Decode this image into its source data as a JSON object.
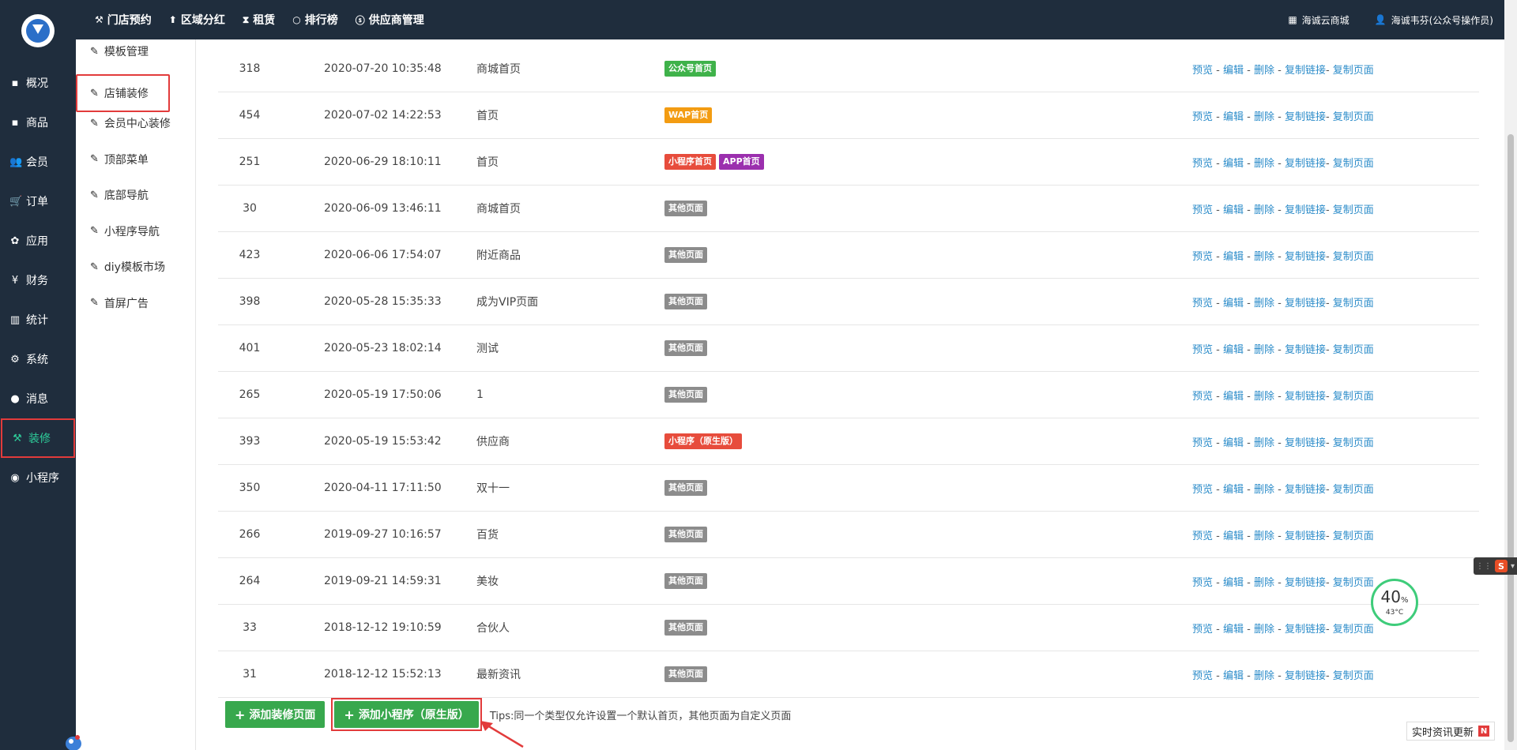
{
  "topnav": [
    {
      "icon": "hammer-icon",
      "glyph": "⚒",
      "label": "门店预约"
    },
    {
      "icon": "pin-icon",
      "glyph": "⬆",
      "label": "区域分红"
    },
    {
      "icon": "hourglass-icon",
      "glyph": "⧗",
      "label": "租赁"
    },
    {
      "icon": "circle-icon",
      "glyph": "○",
      "label": "排行榜"
    },
    {
      "icon": "skype-icon",
      "glyph": "ⓢ",
      "label": "供应商管理"
    }
  ],
  "topright": {
    "shop_label": "海诚云商城",
    "user_label": "海诚韦芬(公众号操作员)"
  },
  "sidebar": [
    {
      "icon": "overview-icon",
      "glyph": "▪",
      "label": "概况"
    },
    {
      "icon": "goods-icon",
      "glyph": "▪",
      "label": "商品"
    },
    {
      "icon": "members-icon",
      "glyph": "👥",
      "label": "会员"
    },
    {
      "icon": "cart-icon",
      "glyph": "🛒",
      "label": "订单"
    },
    {
      "icon": "apps-icon",
      "glyph": "✿",
      "label": "应用"
    },
    {
      "icon": "yen-icon",
      "glyph": "¥",
      "label": "财务"
    },
    {
      "icon": "chart-icon",
      "glyph": "▥",
      "label": "统计"
    },
    {
      "icon": "settings-icon",
      "glyph": "⚙",
      "label": "系统"
    },
    {
      "icon": "message-icon",
      "glyph": "●",
      "label": "消息"
    },
    {
      "icon": "decorate-icon",
      "glyph": "⚒",
      "label": "装修",
      "active": true
    },
    {
      "icon": "wechat-icon",
      "glyph": "◉",
      "label": "小程序"
    }
  ],
  "submenu": [
    {
      "label": "模板管理"
    },
    {
      "label": "店铺装修",
      "active": true
    },
    {
      "label": "会员中心装修"
    },
    {
      "label": "顶部菜单"
    },
    {
      "label": "底部导航"
    },
    {
      "label": "小程序导航"
    },
    {
      "label": "diy模板市场"
    },
    {
      "label": "首屏广告"
    }
  ],
  "tag_colors": {
    "公众号首页": "#3fb24a",
    "WAP首页": "#f39c12",
    "小程序首页": "#e74c3c",
    "APP首页": "#9b2fae",
    "其他页面": "#8c8c8c",
    "小程序（原生版）": "#e74c3c"
  },
  "ops": {
    "preview": "预览",
    "edit": "编辑",
    "delete": "删除",
    "copy_link": "复制链接",
    "copy_page": "复制页面"
  },
  "rows": [
    {
      "id": "318",
      "date": "2020-07-20 10:35:48",
      "name": "商城首页",
      "tags": [
        "公众号首页"
      ]
    },
    {
      "id": "454",
      "date": "2020-07-02 14:22:53",
      "name": "首页",
      "tags": [
        "WAP首页"
      ]
    },
    {
      "id": "251",
      "date": "2020-06-29 18:10:11",
      "name": "首页",
      "tags": [
        "小程序首页",
        "APP首页"
      ]
    },
    {
      "id": "30",
      "date": "2020-06-09 13:46:11",
      "name": "商城首页",
      "tags": [
        "其他页面"
      ]
    },
    {
      "id": "423",
      "date": "2020-06-06 17:54:07",
      "name": "附近商品",
      "tags": [
        "其他页面"
      ]
    },
    {
      "id": "398",
      "date": "2020-05-28 15:35:33",
      "name": "成为VIP页面",
      "tags": [
        "其他页面"
      ]
    },
    {
      "id": "401",
      "date": "2020-05-23 18:02:14",
      "name": "测试",
      "tags": [
        "其他页面"
      ]
    },
    {
      "id": "265",
      "date": "2020-05-19 17:50:06",
      "name": "1",
      "tags": [
        "其他页面"
      ]
    },
    {
      "id": "393",
      "date": "2020-05-19 15:53:42",
      "name": "供应商",
      "tags": [
        "小程序（原生版）"
      ]
    },
    {
      "id": "350",
      "date": "2020-04-11 17:11:50",
      "name": "双十一",
      "tags": [
        "其他页面"
      ]
    },
    {
      "id": "266",
      "date": "2019-09-27 10:16:57",
      "name": "百货",
      "tags": [
        "其他页面"
      ]
    },
    {
      "id": "264",
      "date": "2019-09-21 14:59:31",
      "name": "美妆",
      "tags": [
        "其他页面"
      ]
    },
    {
      "id": "33",
      "date": "2018-12-12 19:10:59",
      "name": "合伙人",
      "tags": [
        "其他页面"
      ]
    },
    {
      "id": "31",
      "date": "2018-12-12 15:52:13",
      "name": "最新资讯",
      "tags": [
        "其他页面"
      ]
    }
  ],
  "buttons": {
    "add_page": "添加装修页面",
    "add_miniprogram": "添加小程序（原生版）"
  },
  "tips": "Tips:同一个类型仅允许设置一个默认首页，其他页面为自定义页面",
  "gauge": {
    "percent": "40",
    "unit": "%",
    "temp": "43°C"
  },
  "news": {
    "label": "实时资讯更新",
    "badge": "N"
  },
  "ime": {
    "badge": "S"
  }
}
